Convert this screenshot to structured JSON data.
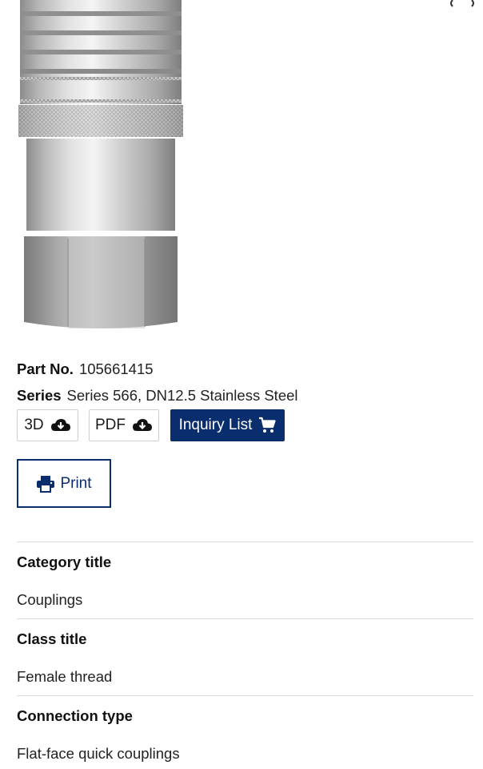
{
  "product": {
    "part_no_label": "Part No.",
    "part_no_value": "105661415",
    "series_label": "Series",
    "series_value": "Series 566, DN12.5 Stainless Steel"
  },
  "actions": {
    "btn_3d": "3D",
    "btn_pdf": "PDF",
    "btn_inquiry": "Inquiry List",
    "btn_print": "Print"
  },
  "attributes": [
    {
      "title": "Category title",
      "value": "Couplings"
    },
    {
      "title": "Class title",
      "value": "Female thread"
    },
    {
      "title": "Connection type",
      "value": "Flat-face quick couplings"
    }
  ],
  "colors": {
    "primary": "#0a2d6e",
    "divider": "#d7d7d7"
  },
  "icons": [
    "cloud-download-icon",
    "cart-icon",
    "printer-icon"
  ]
}
